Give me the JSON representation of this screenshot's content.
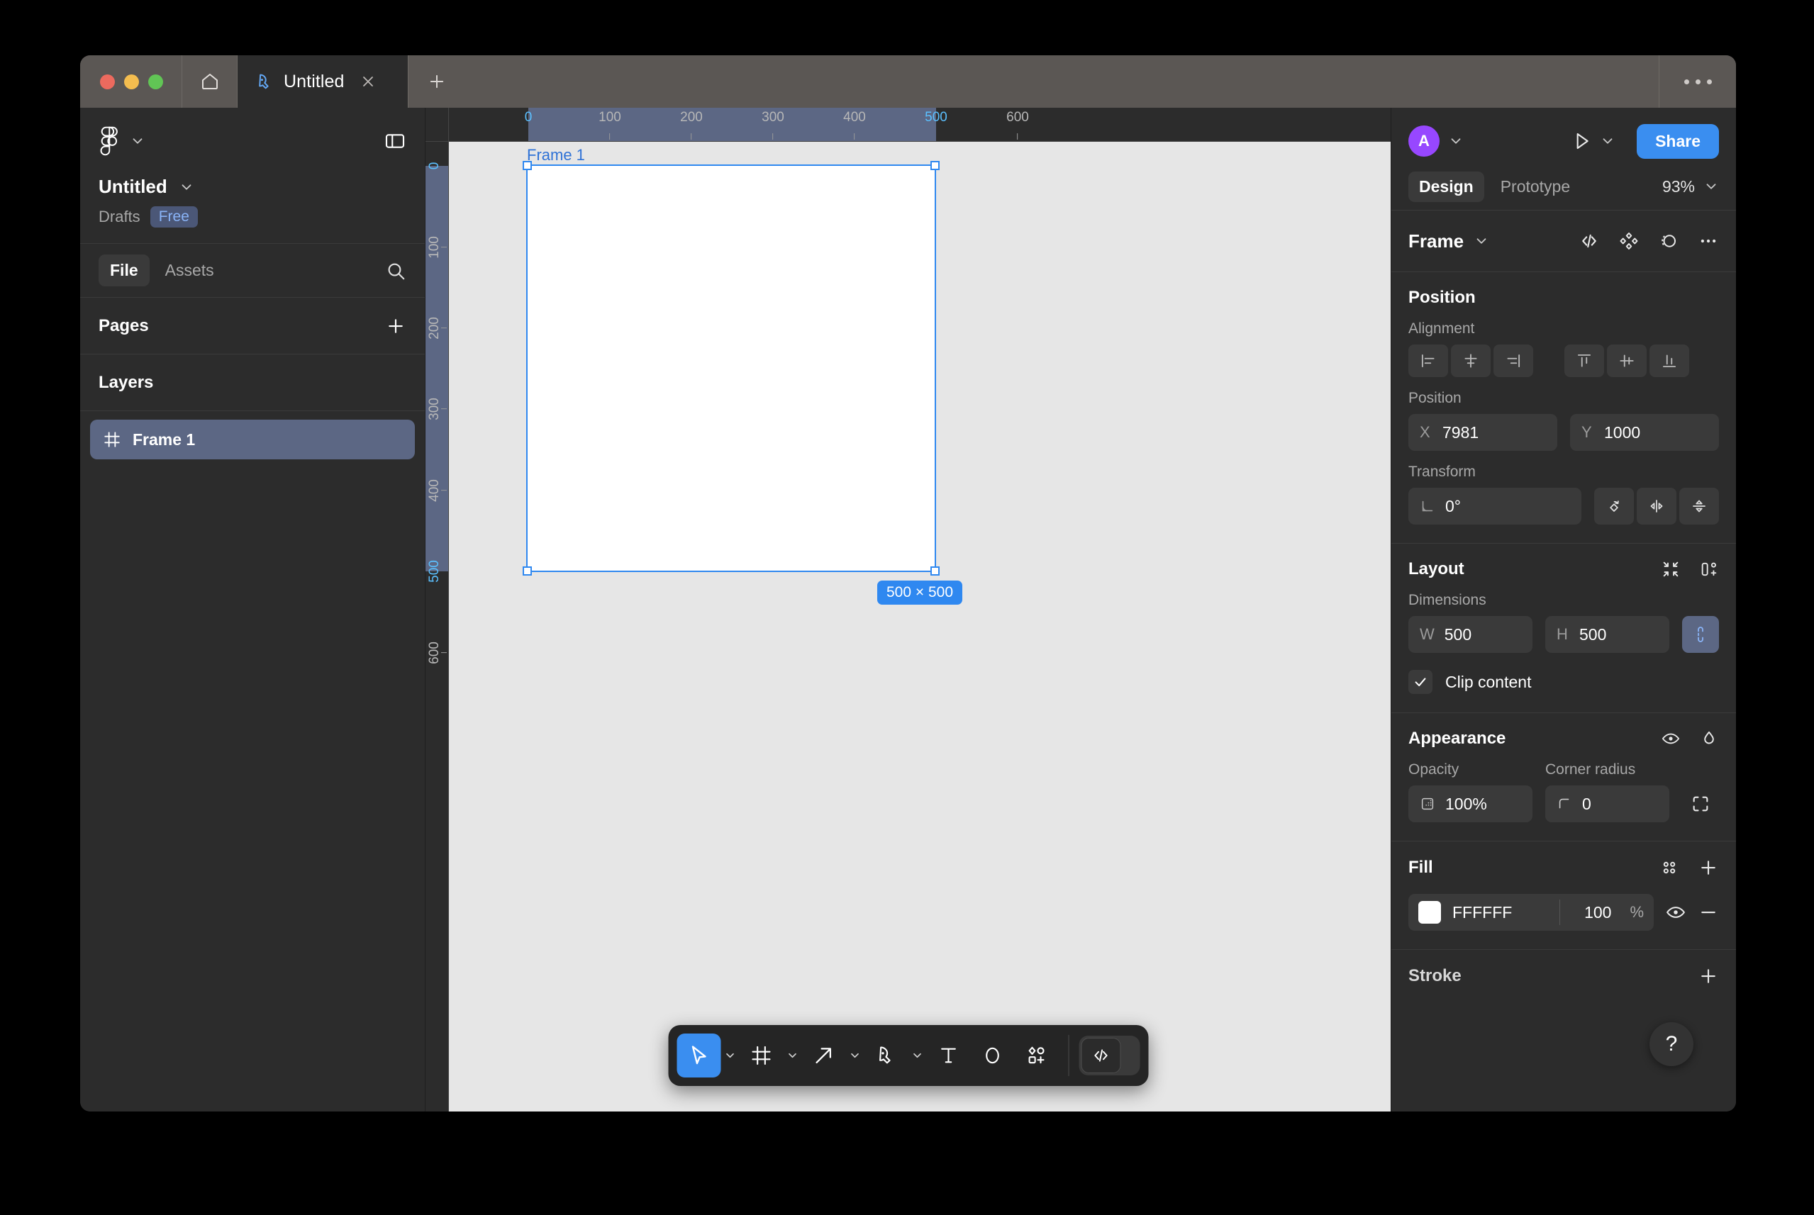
{
  "window": {
    "traffic_lights": [
      "close",
      "minimize",
      "maximize"
    ],
    "home_icon": "home-icon",
    "tab": {
      "icon": "figma-pen-icon",
      "title": "Untitled",
      "close": "×"
    },
    "new_tab": "+",
    "overflow_menu": "•••"
  },
  "left_panel": {
    "logo_icon": "figma-logo-icon",
    "logo_caret": "chevron-down-icon",
    "panel_toggle_icon": "panel-toggle-icon",
    "doc_name": "Untitled",
    "doc_caret": "chevron-down-icon",
    "folder": "Drafts",
    "plan_badge": "Free",
    "tabs": [
      {
        "label": "File",
        "active": true
      },
      {
        "label": "Assets",
        "active": false
      }
    ],
    "search_icon": "search-icon",
    "pages": {
      "title": "Pages",
      "add_icon": "plus-icon"
    },
    "layers": {
      "title": "Layers"
    },
    "layer_items": [
      {
        "icon": "frame-icon",
        "name": "Frame 1",
        "selected": true
      }
    ]
  },
  "canvas": {
    "ruler_h_ticks": [
      "0",
      "100",
      "200",
      "300",
      "400",
      "500",
      "600"
    ],
    "ruler_v_ticks": [
      "0",
      "100",
      "200",
      "300",
      "400",
      "500",
      "600"
    ],
    "ruler_highlight_from": "0",
    "ruler_highlight_to": "500",
    "frame_label": "Frame 1",
    "size_badge": "500 × 500",
    "frame_fill": "#FFFFFF",
    "canvas_bg": "#E6E6E6",
    "selection_color": "#2F88F0"
  },
  "toolbar": {
    "tools": [
      {
        "name": "move-tool",
        "icon": "cursor-icon",
        "active": true,
        "caret": true
      },
      {
        "name": "frame-tool",
        "icon": "frame-icon",
        "active": false,
        "caret": true
      },
      {
        "name": "shape-tool",
        "icon": "arrow-diagonal-icon",
        "active": false,
        "caret": true
      },
      {
        "name": "pen-tool",
        "icon": "pen-icon",
        "active": false,
        "caret": true
      },
      {
        "name": "text-tool",
        "icon": "text-icon",
        "active": false,
        "caret": false
      },
      {
        "name": "comment-tool",
        "icon": "comment-icon",
        "active": false,
        "caret": false
      },
      {
        "name": "actions-tool",
        "icon": "plugins-icon",
        "active": false,
        "caret": false
      }
    ],
    "devmode": {
      "icon": "code-icon",
      "enabled": false
    }
  },
  "right_panel": {
    "avatar": {
      "initial": "A",
      "color": "#9747FF"
    },
    "avatar_caret": "chevron-down-icon",
    "present_icon": "play-icon",
    "present_caret": "chevron-down-icon",
    "share_label": "Share",
    "tabs": [
      {
        "label": "Design",
        "active": true
      },
      {
        "label": "Prototype",
        "active": false
      }
    ],
    "zoom": "93%",
    "zoom_caret": "chevron-down-icon",
    "object": {
      "type": "Frame",
      "caret": "chevron-down-icon",
      "icons": [
        "code-icon",
        "component-icon",
        "mask-icon",
        "more-icon"
      ]
    },
    "position": {
      "title": "Position",
      "alignment_label": "Alignment",
      "align_buttons": [
        "align-left-icon",
        "align-horizontal-center-icon",
        "align-right-icon",
        "align-top-icon",
        "align-vertical-center-icon",
        "align-bottom-icon"
      ],
      "position_label": "Position",
      "x_label": "X",
      "x_value": "7981",
      "y_label": "Y",
      "y_value": "1000",
      "transform_label": "Transform",
      "rotation_icon": "angle-icon",
      "rotation_value": "0°",
      "transform_buttons": [
        "rotate-icon",
        "flip-horizontal-icon",
        "flip-vertical-icon"
      ]
    },
    "layout": {
      "title": "Layout",
      "head_icons": [
        "resize-to-fit-icon",
        "add-auto-layout-icon"
      ],
      "dimensions_label": "Dimensions",
      "w_label": "W",
      "w_value": "500",
      "h_label": "H",
      "h_value": "500",
      "ratio_lock_icon": "link-icon",
      "clip_content_label": "Clip content",
      "clip_content_checked": true
    },
    "appearance": {
      "title": "Appearance",
      "head_icons": [
        "visibility-icon",
        "blend-mode-icon"
      ],
      "opacity_label": "Opacity",
      "opacity_icon": "opacity-icon",
      "opacity_value": "100%",
      "corner_radius_label": "Corner radius",
      "corner_radius_icon": "corner-radius-icon",
      "corner_radius_value": "0",
      "independent_corners_icon": "independent-corners-icon"
    },
    "fill": {
      "title": "Fill",
      "head_icons": [
        "styles-icon",
        "plus-icon"
      ],
      "swatch_color": "#FFFFFF",
      "hex": "FFFFFF",
      "opacity": "100",
      "opacity_unit": "%",
      "visibility_icon": "visibility-icon",
      "remove_icon": "minus-icon"
    },
    "stroke": {
      "title": "Stroke",
      "add_icon": "plus-icon"
    },
    "help_icon": "?"
  }
}
